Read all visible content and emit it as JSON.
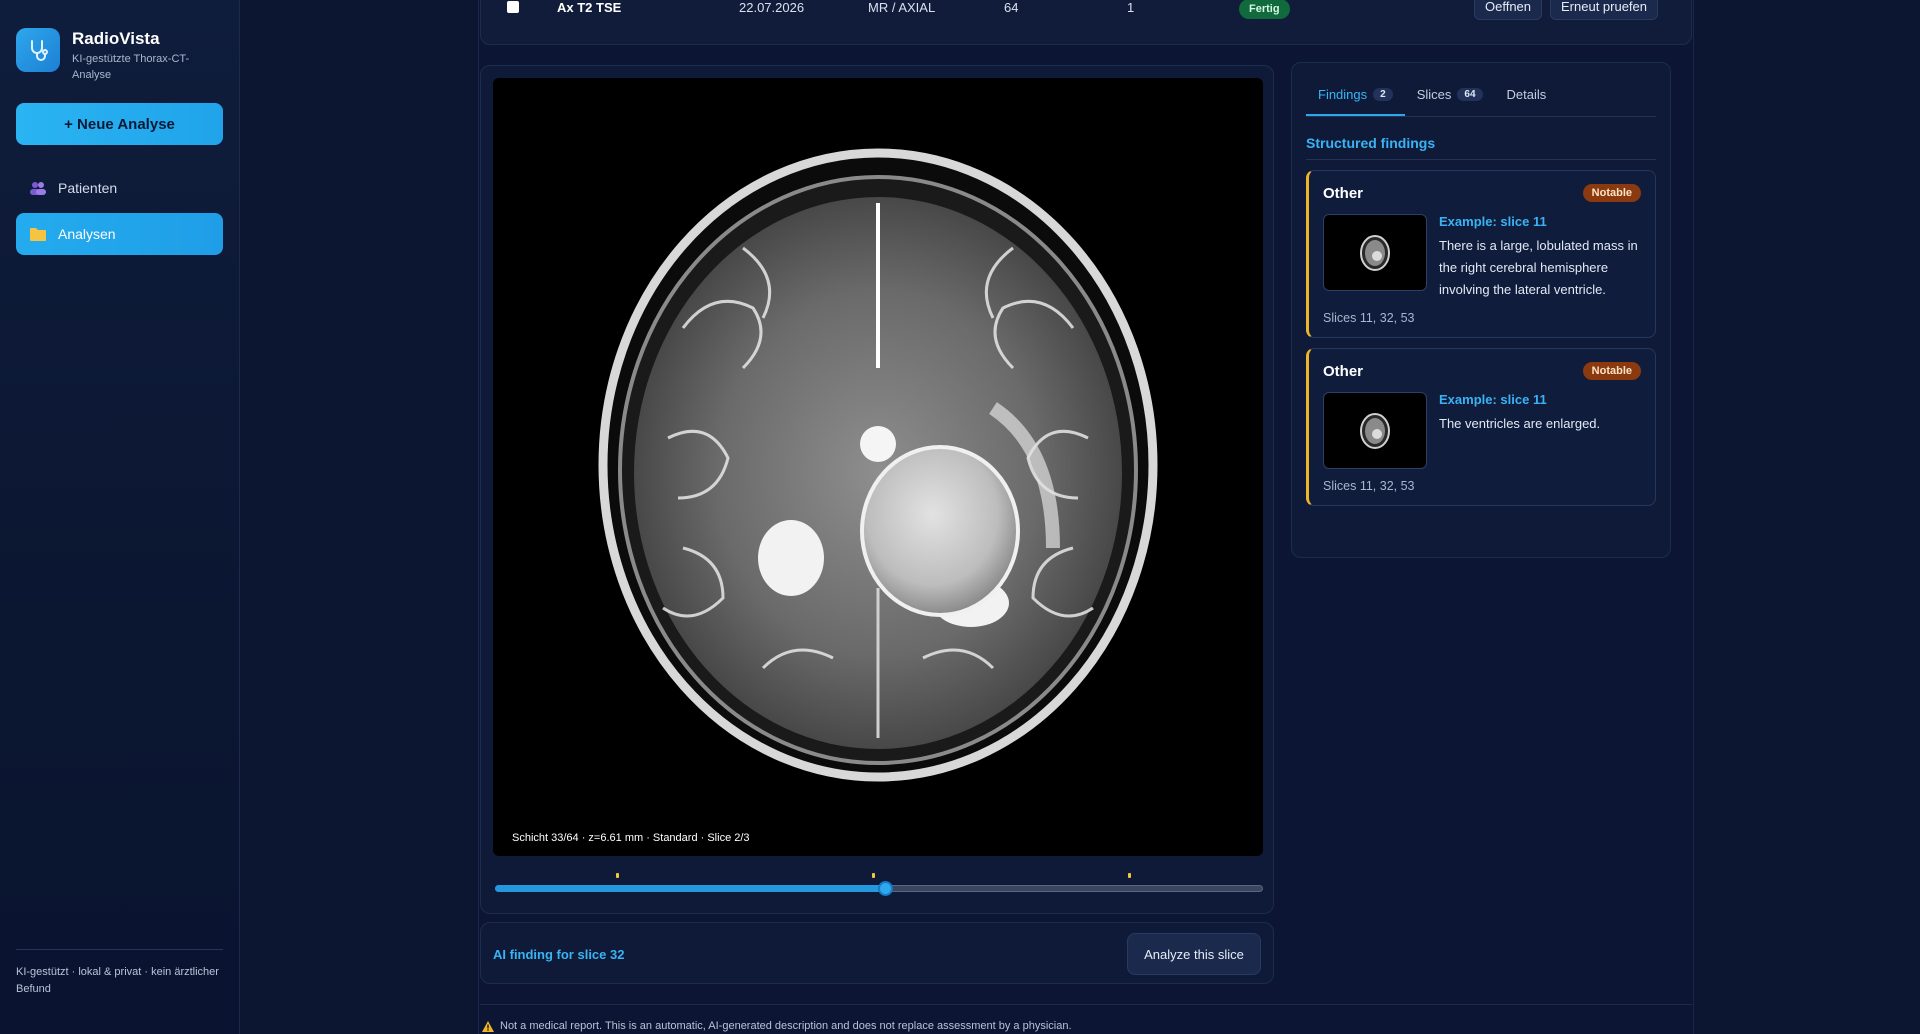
{
  "sidebar": {
    "brand_name": "RadioVista",
    "brand_subtitle": "KI-gestützte Thorax-CT-Analyse",
    "new_analysis": "+ Neue Analyse",
    "nav": [
      {
        "label": "Patienten",
        "icon": "users-icon",
        "active": false
      },
      {
        "label": "Analysen",
        "icon": "folder-icon",
        "active": true
      }
    ],
    "footer": "KI-gestützt · lokal & privat · kein ärztlicher Befund"
  },
  "series_row": {
    "name": "Ax T2 TSE",
    "date": "22.07.2026",
    "modality": "MR / AXIAL",
    "slices": "64",
    "number": "1",
    "status": "Fertig",
    "open_label": "Oeffnen",
    "retry_label": "Erneut pruefen"
  },
  "viewer": {
    "caption": "Schicht 33/64 · z=6.61 mm · Standard · Slice 2/3",
    "slider": {
      "current": 33,
      "total": 64,
      "markers": [
        11,
        32,
        53
      ]
    }
  },
  "ai_panel": {
    "title": "AI finding for slice 32",
    "button": "Analyze this slice"
  },
  "findings": {
    "tabs": [
      {
        "label": "Findings",
        "count": "2",
        "active": true
      },
      {
        "label": "Slices",
        "count": "64",
        "active": false
      },
      {
        "label": "Details",
        "count": null,
        "active": false
      }
    ],
    "section_title": "Structured findings",
    "items": [
      {
        "category": "Other",
        "badge": "Notable",
        "example": "Example: slice 11",
        "text": "There is a large, lobulated mass in the right cerebral hemisphere involving the lateral ventricle.",
        "slices": "Slices 11, 32, 53"
      },
      {
        "category": "Other",
        "badge": "Notable",
        "example": "Example: slice 11",
        "text": "The ventricles are enlarged.",
        "slices": "Slices 11, 32, 53"
      }
    ]
  },
  "disclaimer": "Not a medical report. This is an automatic, AI-generated description and does not replace assessment by a physician.",
  "colors": {
    "accent": "#2ea7ec",
    "warning": "#f0b429",
    "done": "#116a3c",
    "notable": "#8b3a10"
  }
}
